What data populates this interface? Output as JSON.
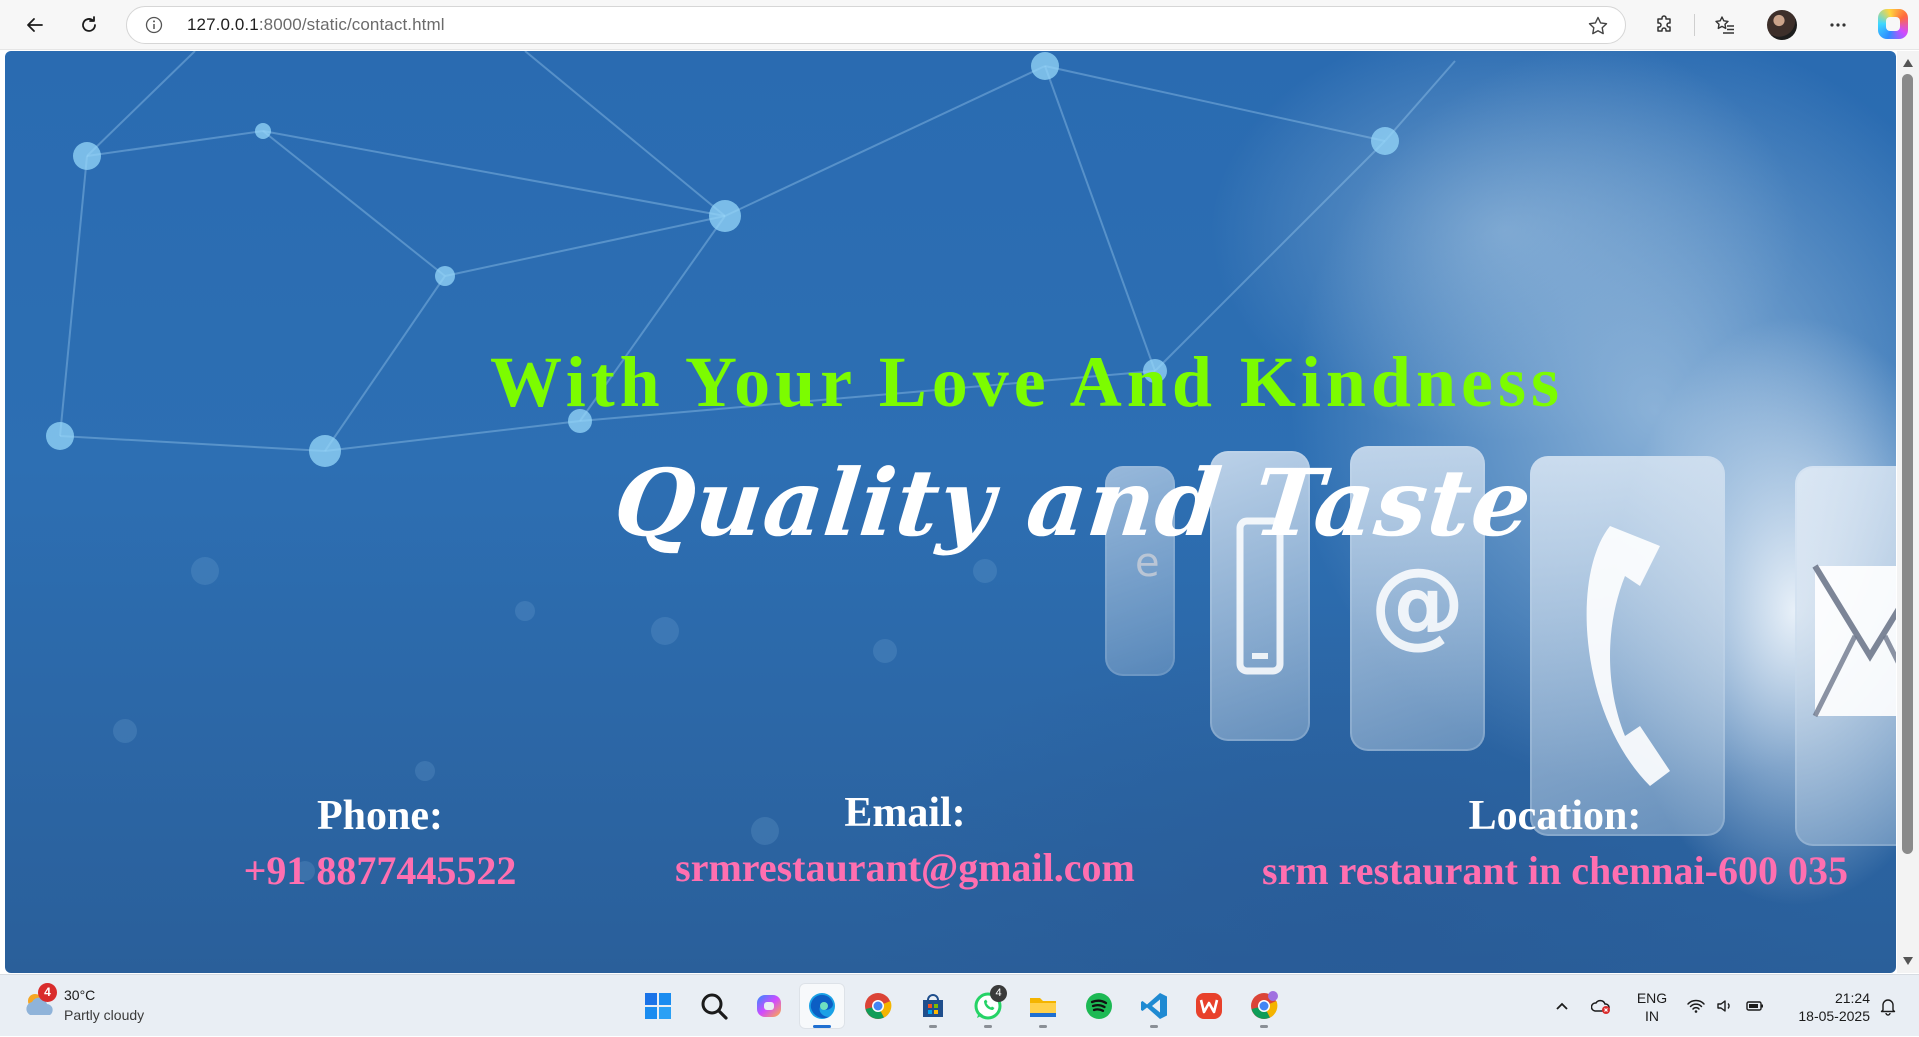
{
  "browser": {
    "url_host": "127.0.0.1",
    "url_path": ":8000/static/contact.html",
    "icons": [
      "back-arrow-icon",
      "refresh-icon",
      "site-info-icon",
      "favorite-star-icon",
      "extensions-icon",
      "favorites-list-icon",
      "profile-avatar",
      "more-options-icon",
      "copilot-icon"
    ]
  },
  "page": {
    "headline": "With Your Love And Kindness",
    "subtitle": "Quality and Taste",
    "contacts": {
      "phone": {
        "label": "Phone:",
        "value": "+91 8877445522"
      },
      "email": {
        "label": "Email:",
        "value": "srmrestaurant@gmail.com"
      },
      "location": {
        "label": "Location:",
        "value": "srm restaurant in chennai-600 035"
      }
    },
    "colors": {
      "headline": "#7cfc00",
      "subtitle": "#ffffff",
      "contact_label": "#ffffff",
      "contact_value": "#ff6fb0",
      "background": "#2c6aae"
    }
  },
  "taskbar": {
    "weather": {
      "badge": "4",
      "temperature": "30°C",
      "condition": "Partly cloudy"
    },
    "apps": [
      {
        "name": "start-button",
        "icon": "windows-icon"
      },
      {
        "name": "search-button",
        "icon": "search-icon"
      },
      {
        "name": "copilot-app",
        "icon": "copilot-icon"
      },
      {
        "name": "edge-app",
        "icon": "edge-icon",
        "active": true
      },
      {
        "name": "chrome-app",
        "icon": "chrome-icon"
      },
      {
        "name": "store-app",
        "icon": "store-icon"
      },
      {
        "name": "whatsapp-app",
        "icon": "whatsapp-icon",
        "badge": "4"
      },
      {
        "name": "file-explorer-app",
        "icon": "folder-icon"
      },
      {
        "name": "spotify-app",
        "icon": "spotify-icon"
      },
      {
        "name": "vscode-app",
        "icon": "vscode-icon"
      },
      {
        "name": "wps-office-app",
        "icon": "wps-icon"
      },
      {
        "name": "chrome-profile-app",
        "icon": "chrome-icon"
      }
    ],
    "language": {
      "line1": "ENG",
      "line2": "IN"
    },
    "clock": {
      "time": "21:24",
      "date": "18-05-2025"
    }
  }
}
